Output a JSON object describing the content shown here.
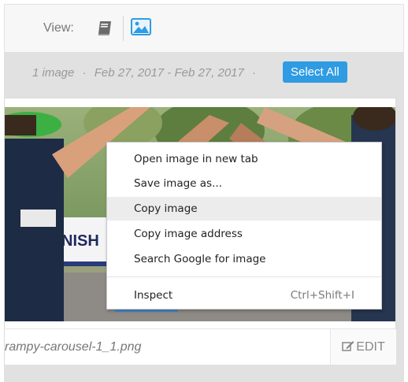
{
  "toolbar": {
    "view_label": "View:",
    "icons": [
      "book-icon",
      "image-icon"
    ]
  },
  "gallery": {
    "count_text": "1 image",
    "date_range": "Feb 27, 2017 - Feb 27, 2017",
    "select_all_label": "Select All"
  },
  "card": {
    "file_name": "rampy-carousel-1_1.png",
    "edit_label": "EDIT"
  },
  "context_menu": {
    "items": [
      {
        "label": "Open image in new tab",
        "shortcut": ""
      },
      {
        "label": "Save image as...",
        "shortcut": ""
      },
      {
        "label": "Copy image",
        "shortcut": ""
      },
      {
        "label": "Copy image address",
        "shortcut": ""
      },
      {
        "label": "Search Google for image",
        "shortcut": ""
      },
      {
        "label": "Inspect",
        "shortcut": "Ctrl+Shift+I"
      }
    ],
    "highlighted_index": 2
  },
  "photo": {
    "banner_text": "NISH"
  },
  "colors": {
    "accent": "#2f9be3",
    "gallery_bg": "#e1e1e1",
    "menu_highlight": "#ececec"
  }
}
